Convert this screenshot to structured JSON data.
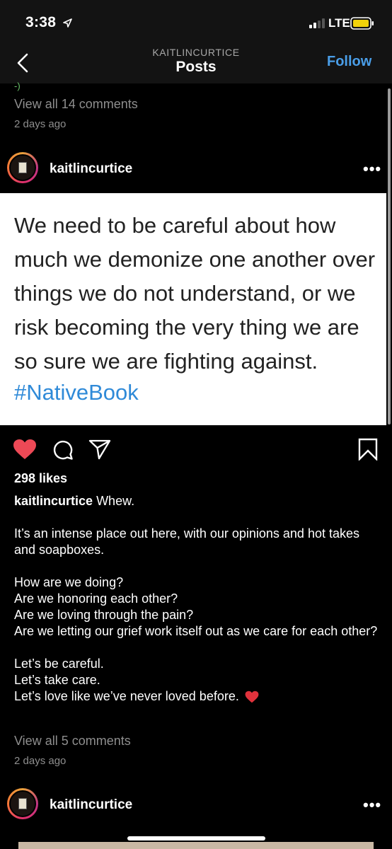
{
  "status": {
    "time": "3:38",
    "network": "LTE"
  },
  "nav": {
    "username": "KAITLINCURTICE",
    "title": "Posts",
    "follow_label": "Follow"
  },
  "prev_post": {
    "cut_text": "-)",
    "view_comments": "View all 14 comments",
    "time_ago": "2 days ago"
  },
  "post": {
    "username": "kaitlincurtice",
    "more": "•••",
    "image_quote": "We need to be careful about how much we demonize one another over things we do not understand, or we risk becoming the very thing we are so sure we are fighting against.",
    "image_hashtag": "#NativeBook",
    "likes": "298 likes",
    "caption_user": "kaitlincurtice",
    "caption_lines": [
      "Whew.",
      "It’s an intense place out here, with our opinions and hot takes and soapboxes.",
      "How are we doing?",
      "Are we honoring each other?",
      "Are we loving through the pain?",
      "Are we letting our grief work itself out as we care for each other?",
      "Let’s be careful.",
      "Let’s take care.",
      "Let’s love like we’ve never loved before."
    ],
    "view_comments": "View all 5 comments",
    "time_ago": "2 days ago",
    "liked": true,
    "like_color": "#ed4956"
  },
  "next_post": {
    "username": "kaitlincurtice",
    "more": "•••"
  },
  "colors": {
    "accent": "#4a9ee8",
    "hashtag": "#2f8ad8"
  }
}
